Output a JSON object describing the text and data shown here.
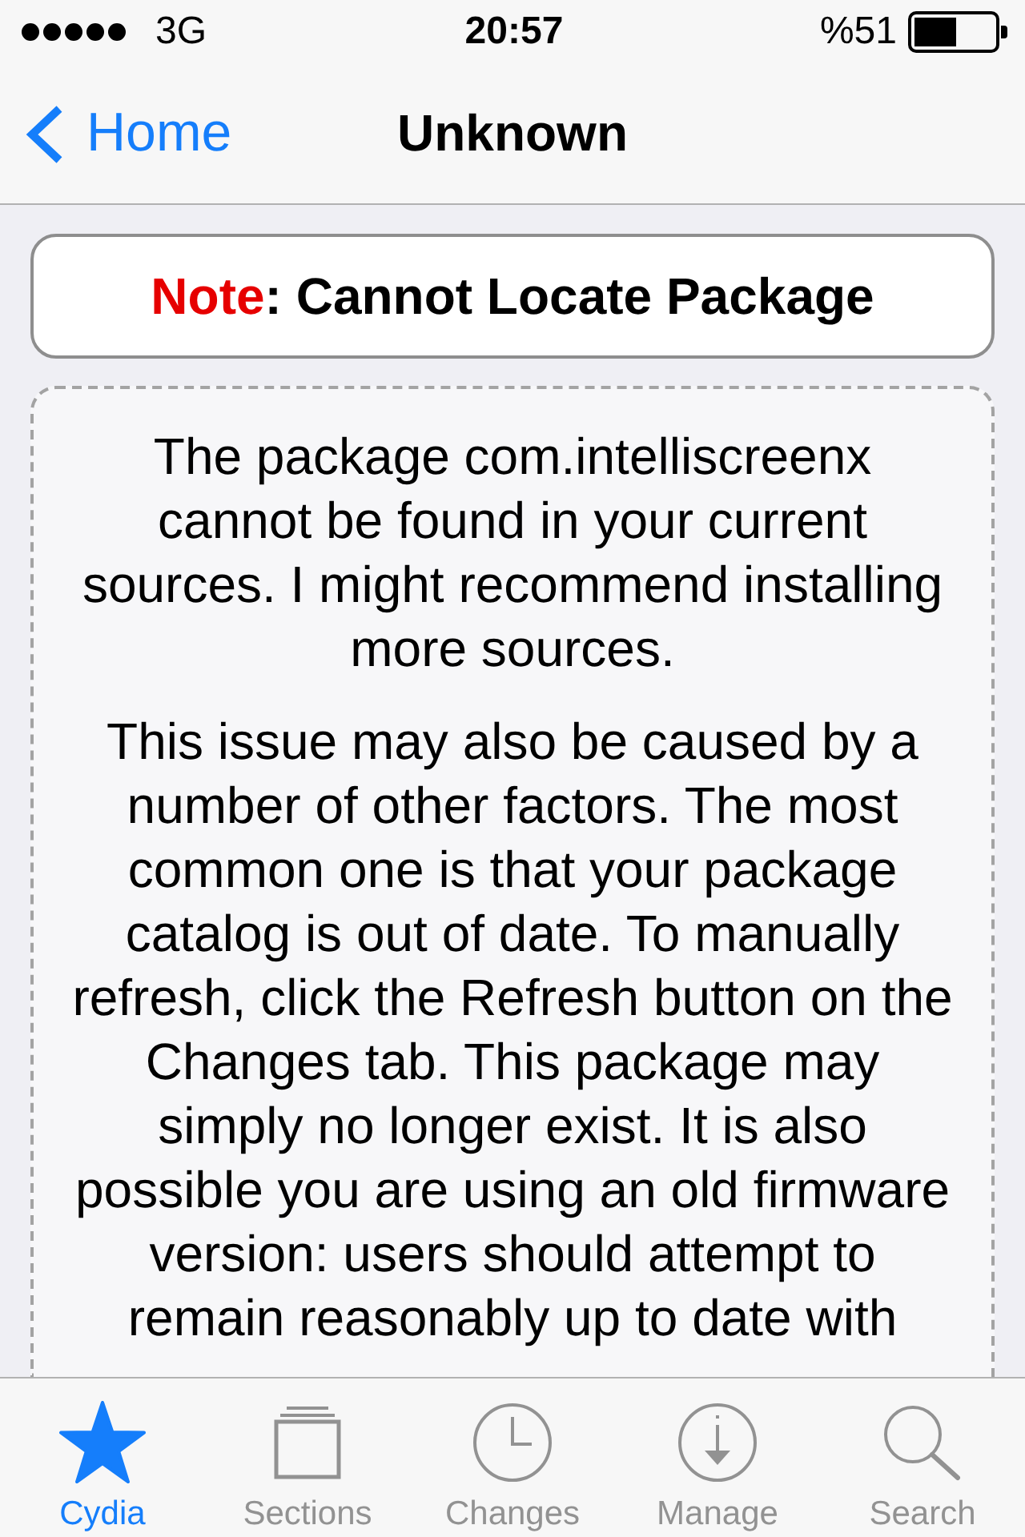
{
  "status_bar": {
    "network": "3G",
    "time": "20:57",
    "battery": "%51"
  },
  "nav_bar": {
    "back": "Home",
    "title": "Unknown"
  },
  "note": {
    "label": "Note",
    "text": ": Cannot Locate Package"
  },
  "message": {
    "paragraphs": [
      "The package com.intelliscreenx cannot be found in your current sources. I might recommend installing more sources.",
      "This issue may also be caused by a number of other factors. The most common one is that your package catalog is out of date. To manually refresh, click the Refresh button on the Changes tab. This package may simply no longer exist. It is also possible you are using an old firmware version: users should attempt to remain reasonably up to date with"
    ]
  },
  "tab_bar": {
    "tabs": [
      {
        "label": "Cydia",
        "selected": true
      },
      {
        "label": "Sections",
        "selected": false
      },
      {
        "label": "Changes",
        "selected": false
      },
      {
        "label": "Manage",
        "selected": false
      },
      {
        "label": "Search",
        "selected": false
      }
    ]
  }
}
